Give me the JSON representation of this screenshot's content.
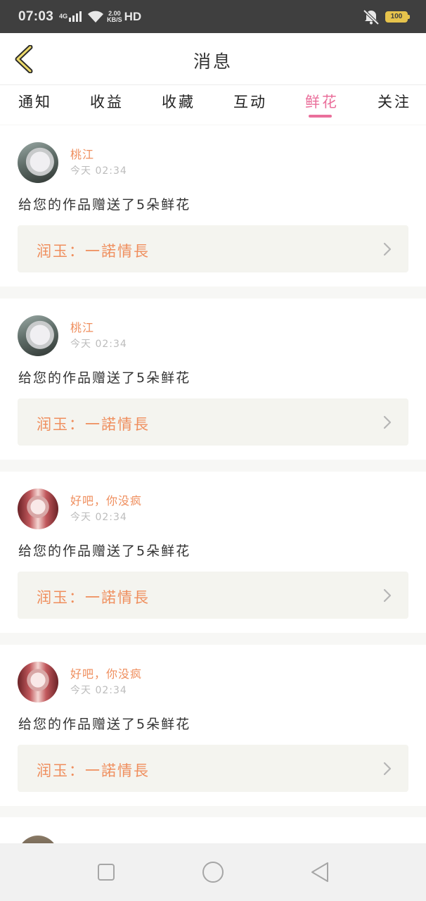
{
  "status_bar": {
    "time": "07:03",
    "network": "4G",
    "speed_value": "2.00",
    "speed_unit": "KB/S",
    "hd": "HD",
    "battery": "100",
    "icons": [
      "signal-icon",
      "wifi-icon",
      "mute-icon",
      "battery-icon"
    ]
  },
  "header": {
    "title": "消息",
    "back_icon": "chevron-left-icon"
  },
  "tabs": [
    {
      "label": "通知",
      "active": false
    },
    {
      "label": "收益",
      "active": false
    },
    {
      "label": "收藏",
      "active": false
    },
    {
      "label": "互动",
      "active": false
    },
    {
      "label": "鲜花",
      "active": true
    },
    {
      "label": "关注",
      "active": false
    }
  ],
  "colors": {
    "accent": "#ea6f9b",
    "username": "#ef8e5d",
    "work_bg": "#f4f4ef",
    "status_bar": "#3f3f3f"
  },
  "messages": [
    {
      "username": "桃江",
      "time": "今天 02:34",
      "text": "给您的作品赠送了5朵鲜花",
      "work": "润玉：一諾情長"
    },
    {
      "username": "桃江",
      "time": "今天 02:34",
      "text": "给您的作品赠送了5朵鲜花",
      "work": "润玉：一諾情長"
    },
    {
      "username": "好吧，你没疯",
      "time": "今天 02:34",
      "text": "给您的作品赠送了5朵鲜花",
      "work": "润玉：一諾情長"
    },
    {
      "username": "好吧，你没疯",
      "time": "今天 02:34",
      "text": "给您的作品赠送了5朵鲜花",
      "work": "润玉：一諾情長"
    }
  ],
  "nav": {
    "icons": [
      "recent-apps-icon",
      "home-icon",
      "back-triangle-icon"
    ]
  }
}
